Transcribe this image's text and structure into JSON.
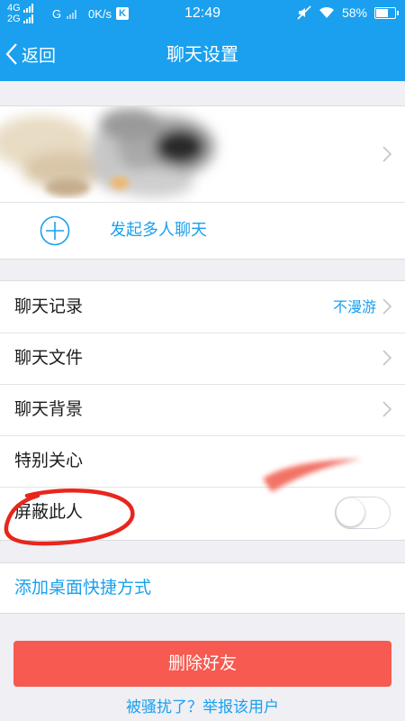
{
  "status_bar": {
    "net_top": "4G",
    "net_bottom": "2G",
    "net_g": "G",
    "speed": "0K/s",
    "k_badge": "K",
    "time": "12:49",
    "battery": "58%",
    "icons": [
      "signal-bars-icon",
      "mute-icon",
      "wifi-icon",
      "battery-icon"
    ]
  },
  "nav": {
    "back_label": "返回",
    "title": "聊天设置"
  },
  "profile": {
    "start_group_chat": "发起多人聊天"
  },
  "settings": {
    "chat_history": "聊天记录",
    "chat_history_value": "不漫游",
    "chat_files": "聊天文件",
    "chat_background": "聊天背景",
    "special_care": "特别关心",
    "block_user": "屏蔽此人",
    "block_user_on": false
  },
  "shortcut": {
    "label": "添加桌面快捷方式"
  },
  "actions": {
    "delete_friend": "删除好友",
    "report": "被骚扰了？举报该用户"
  },
  "colors": {
    "primary": "#1aa0ee",
    "danger": "#f75a50",
    "annotation": "#e8261c"
  }
}
